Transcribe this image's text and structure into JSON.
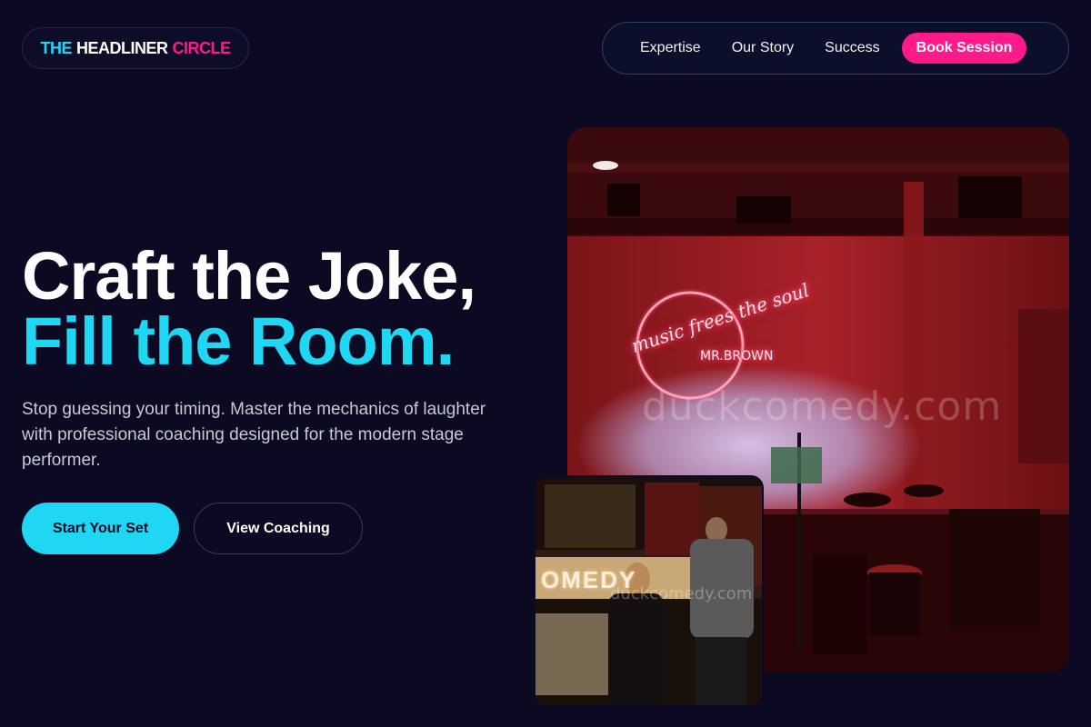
{
  "brand": {
    "part1": "THE",
    "part2": "HEADLINER",
    "part3": "CIRCLE"
  },
  "nav": {
    "items": [
      "Expertise",
      "Our Story",
      "Success"
    ],
    "cta": "Book Session"
  },
  "hero": {
    "line1": "Craft the Joke,",
    "line2": "Fill the Room.",
    "subtitle": "Stop guessing your timing. Master the mechanics of laughter with professional coaching designed for the modern stage performer.",
    "primary_button": "Start Your Set",
    "secondary_button": "View Coaching"
  },
  "images": {
    "main": {
      "neon_script": "music frees the soul",
      "neon_name": "MR.BROWN",
      "watermark": "duckcomedy.com"
    },
    "small": {
      "sign": "OMEDY",
      "watermark": "duckcomedy.com"
    }
  },
  "colors": {
    "background": "#0b0a22",
    "accent_cyan": "#1fd7f2",
    "accent_pink": "#ff1a8c"
  }
}
